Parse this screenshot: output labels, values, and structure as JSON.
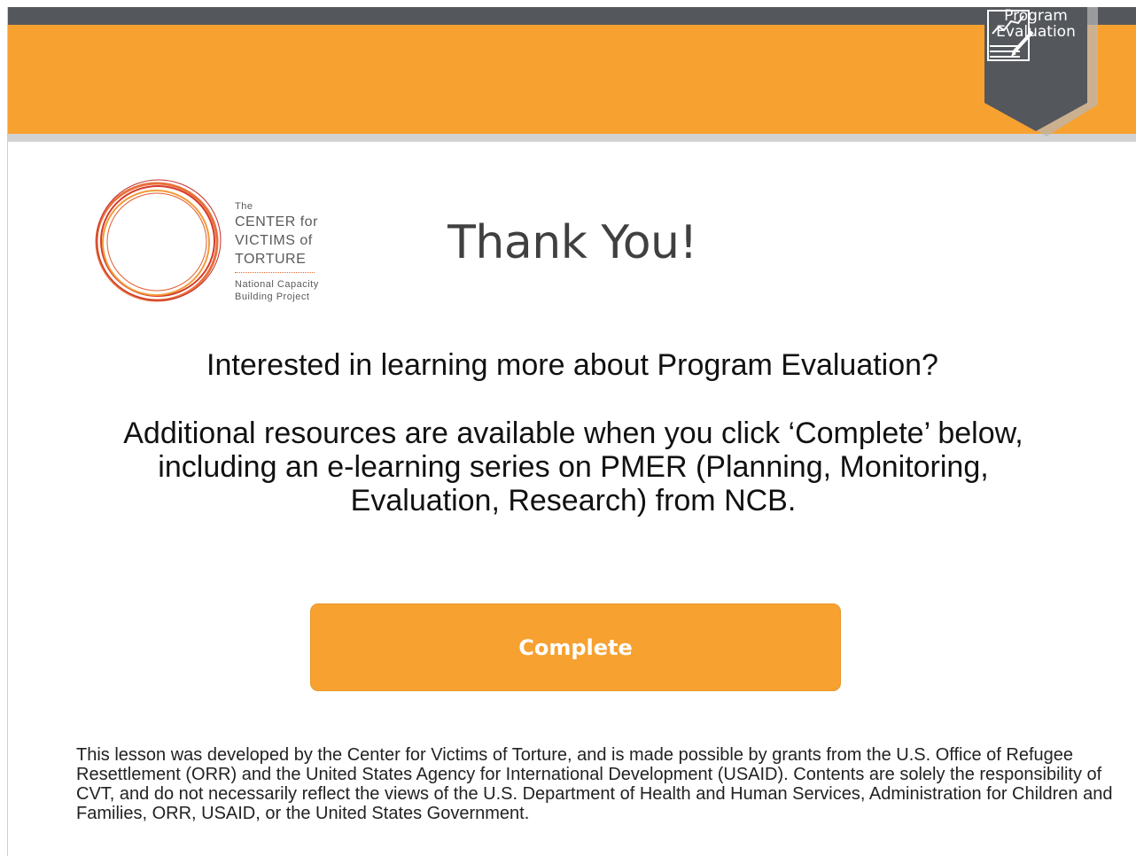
{
  "header": {
    "badge_title": "Program Evaluation",
    "badge_icon": "chart-clipboard-icon",
    "colors": {
      "banner": "#f7a131",
      "topbar": "#54575c",
      "badge": "#54575c"
    }
  },
  "logo": {
    "line1": "The",
    "line2": "CENTER for",
    "line3": "VICTIMS of",
    "line4": "TORTURE",
    "line5": "National Capacity",
    "line6": "Building Project"
  },
  "main": {
    "title": "Thank You!",
    "question": "Interested in learning more about Program Evaluation?",
    "resources": "Additional resources are available when you click ‘Complete’ below, including an e-learning series on PMER (Planning, Monitoring, Evaluation, Research) from NCB."
  },
  "actions": {
    "complete_label": "Complete"
  },
  "footer": {
    "disclaimer": "This lesson was developed by the Center for Victims of Torture, and is made possible by grants from the U.S. Office of Refugee Resettlement (ORR) and the United States Agency for International Development (USAID). Contents are solely the responsibility of CVT, and do not necessarily reflect the views of the U.S. Department of Health and Human Services, Administration for Children and Families, ORR, USAID, or the United States Government."
  }
}
